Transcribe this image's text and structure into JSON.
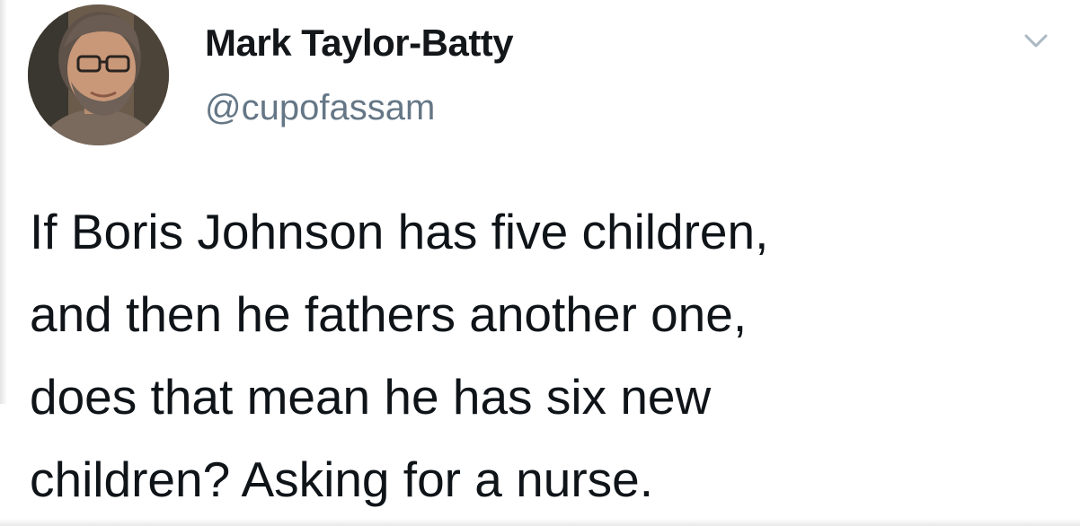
{
  "tweet": {
    "author": {
      "display_name": "Mark Taylor-Batty",
      "handle": "@cupofassam",
      "avatar": "profile-photo-avatar"
    },
    "menu_icon": "chevron-down-icon",
    "text_lines": [
      "If Boris Johnson has five children,",
      "and then he fathers another one,",
      "does that mean he has six new",
      "children? Asking for a nurse."
    ],
    "colors": {
      "name": "#14171a",
      "handle": "#657786",
      "body": "#0f1419",
      "caret": "#aab8c2"
    }
  }
}
